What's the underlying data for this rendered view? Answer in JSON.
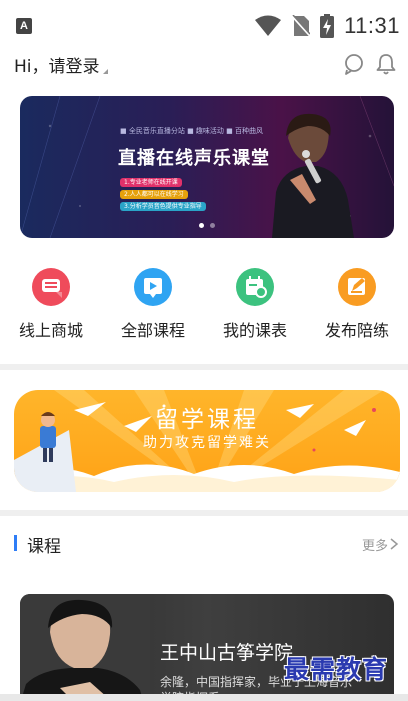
{
  "status_bar": {
    "app_badge": "A",
    "time": "11:31"
  },
  "header": {
    "greeting": "Hi，请登录"
  },
  "banner": {
    "topline": "■ 全民音乐直播分站    ■ 趣味活动    ■ 百种曲风",
    "title": "直播在线声乐课堂",
    "chips": [
      "1.专业老师在线开课",
      "2.人人都可以在线学习",
      "3.分析学员音色提供专业指导"
    ],
    "chip_colors": [
      "#e0316a",
      "#e6a10c",
      "#2aa4c8"
    ],
    "dots": 2,
    "active_dot": 0
  },
  "quicknav": [
    {
      "label": "线上商城",
      "icon": "shop-icon",
      "color": "#ef4b5b"
    },
    {
      "label": "全部课程",
      "icon": "video-course-icon",
      "color": "#2fa4f2"
    },
    {
      "label": "我的课表",
      "icon": "schedule-icon",
      "color": "#3cc27f"
    },
    {
      "label": "发布陪练",
      "icon": "edit-publish-icon",
      "color": "#f99c22"
    }
  ],
  "promo": {
    "title": "留学课程",
    "subtitle": "助力攻克留学难关"
  },
  "section": {
    "title": "课程",
    "more": "更多",
    "accent": "#2f7df6"
  },
  "course": {
    "title": "王中山古筝学院",
    "desc_line1": "余隆，中国指挥家，毕业于上海音乐",
    "desc_line2": "学院指挥系"
  },
  "watermark": "最需教育"
}
